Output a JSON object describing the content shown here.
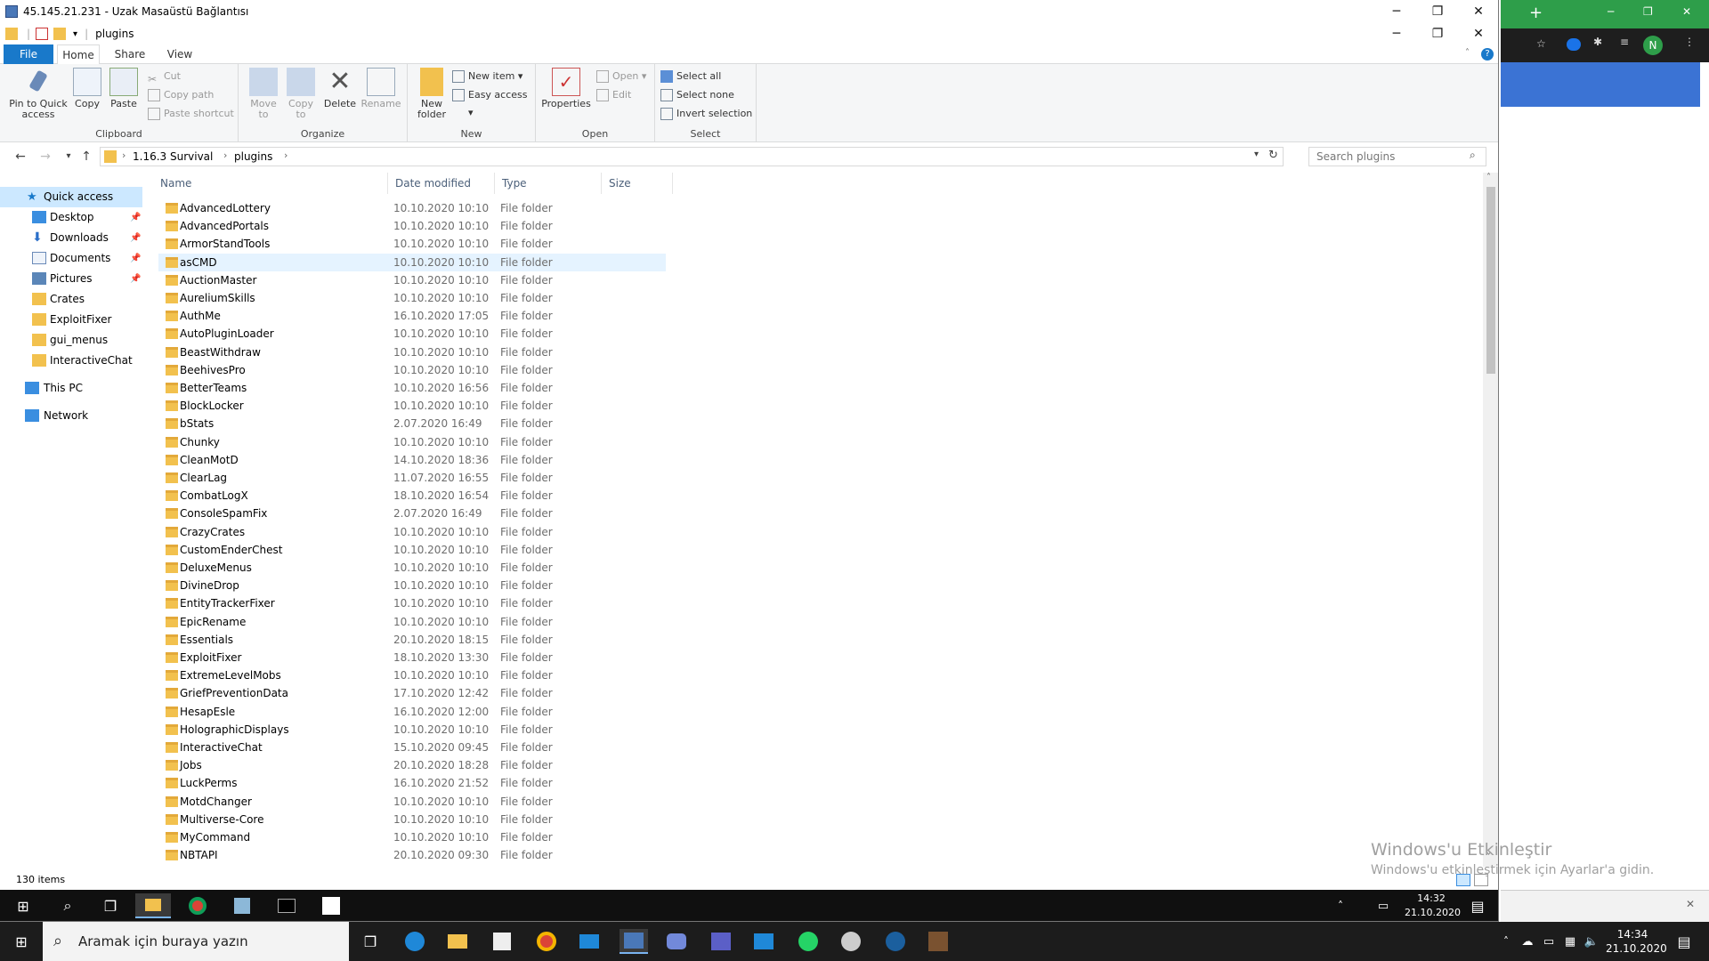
{
  "window": {
    "rdp_title": "45.145.21.231 - Uzak Masaüstü Bağlantısı",
    "explorer_title": "plugins",
    "controls": {
      "minimize": "─",
      "restore": "❐",
      "close": "✕"
    }
  },
  "ribbon": {
    "tabs": {
      "file": "File",
      "home": "Home",
      "share": "Share",
      "view": "View"
    },
    "clipboard": {
      "label": "Clipboard",
      "pin": "Pin to Quick access",
      "copy": "Copy",
      "paste": "Paste",
      "cut": "Cut",
      "copy_path": "Copy path",
      "paste_shortcut": "Paste shortcut"
    },
    "organize": {
      "label": "Organize",
      "move_to": "Move to",
      "copy_to": "Copy to",
      "delete": "Delete",
      "rename": "Rename"
    },
    "new": {
      "label": "New",
      "new_folder": "New folder",
      "new_item": "New item",
      "easy_access": "Easy access"
    },
    "open": {
      "label": "Open",
      "properties": "Properties",
      "open": "Open",
      "edit": "Edit"
    },
    "select": {
      "label": "Select",
      "select_all": "Select all",
      "select_none": "Select none",
      "invert": "Invert selection"
    }
  },
  "address": {
    "crumb1": "1.16.3 Survival",
    "crumb2": "plugins",
    "search_placeholder": "Search plugins"
  },
  "nav": {
    "quick_access": "Quick access",
    "items": [
      "Desktop",
      "Downloads",
      "Documents",
      "Pictures",
      "Crates",
      "ExploitFixer",
      "gui_menus",
      "InteractiveChat"
    ],
    "this_pc": "This PC",
    "network": "Network"
  },
  "columns": {
    "name": "Name",
    "date": "Date modified",
    "type": "Type",
    "size": "Size"
  },
  "files": [
    {
      "name": "AdvancedLottery",
      "date": "10.10.2020 10:10",
      "type": "File folder"
    },
    {
      "name": "AdvancedPortals",
      "date": "10.10.2020 10:10",
      "type": "File folder"
    },
    {
      "name": "ArmorStandTools",
      "date": "10.10.2020 10:10",
      "type": "File folder"
    },
    {
      "name": "asCMD",
      "date": "10.10.2020 10:10",
      "type": "File folder"
    },
    {
      "name": "AuctionMaster",
      "date": "10.10.2020 10:10",
      "type": "File folder"
    },
    {
      "name": "AureliumSkills",
      "date": "10.10.2020 10:10",
      "type": "File folder"
    },
    {
      "name": "AuthMe",
      "date": "16.10.2020 17:05",
      "type": "File folder"
    },
    {
      "name": "AutoPluginLoader",
      "date": "10.10.2020 10:10",
      "type": "File folder"
    },
    {
      "name": "BeastWithdraw",
      "date": "10.10.2020 10:10",
      "type": "File folder"
    },
    {
      "name": "BeehivesPro",
      "date": "10.10.2020 10:10",
      "type": "File folder"
    },
    {
      "name": "BetterTeams",
      "date": "10.10.2020 16:56",
      "type": "File folder"
    },
    {
      "name": "BlockLocker",
      "date": "10.10.2020 10:10",
      "type": "File folder"
    },
    {
      "name": "bStats",
      "date": "2.07.2020 16:49",
      "type": "File folder"
    },
    {
      "name": "Chunky",
      "date": "10.10.2020 10:10",
      "type": "File folder"
    },
    {
      "name": "CleanMotD",
      "date": "14.10.2020 18:36",
      "type": "File folder"
    },
    {
      "name": "ClearLag",
      "date": "11.07.2020 16:55",
      "type": "File folder"
    },
    {
      "name": "CombatLogX",
      "date": "18.10.2020 16:54",
      "type": "File folder"
    },
    {
      "name": "ConsoleSpamFix",
      "date": "2.07.2020 16:49",
      "type": "File folder"
    },
    {
      "name": "CrazyCrates",
      "date": "10.10.2020 10:10",
      "type": "File folder"
    },
    {
      "name": "CustomEnderChest",
      "date": "10.10.2020 10:10",
      "type": "File folder"
    },
    {
      "name": "DeluxeMenus",
      "date": "10.10.2020 10:10",
      "type": "File folder"
    },
    {
      "name": "DivineDrop",
      "date": "10.10.2020 10:10",
      "type": "File folder"
    },
    {
      "name": "EntityTrackerFixer",
      "date": "10.10.2020 10:10",
      "type": "File folder"
    },
    {
      "name": "EpicRename",
      "date": "10.10.2020 10:10",
      "type": "File folder"
    },
    {
      "name": "Essentials",
      "date": "20.10.2020 18:15",
      "type": "File folder"
    },
    {
      "name": "ExploitFixer",
      "date": "18.10.2020 13:30",
      "type": "File folder"
    },
    {
      "name": "ExtremeLevelMobs",
      "date": "10.10.2020 10:10",
      "type": "File folder"
    },
    {
      "name": "GriefPreventionData",
      "date": "17.10.2020 12:42",
      "type": "File folder"
    },
    {
      "name": "HesapEsle",
      "date": "16.10.2020 12:00",
      "type": "File folder"
    },
    {
      "name": "HolographicDisplays",
      "date": "10.10.2020 10:10",
      "type": "File folder"
    },
    {
      "name": "InteractiveChat",
      "date": "15.10.2020 09:45",
      "type": "File folder"
    },
    {
      "name": "Jobs",
      "date": "20.10.2020 18:28",
      "type": "File folder"
    },
    {
      "name": "LuckPerms",
      "date": "16.10.2020 21:52",
      "type": "File folder"
    },
    {
      "name": "MotdChanger",
      "date": "10.10.2020 10:10",
      "type": "File folder"
    },
    {
      "name": "Multiverse-Core",
      "date": "10.10.2020 10:10",
      "type": "File folder"
    },
    {
      "name": "MyCommand",
      "date": "10.10.2020 10:10",
      "type": "File folder"
    },
    {
      "name": "NBTAPI",
      "date": "20.10.2020 09:30",
      "type": "File folder"
    }
  ],
  "status": "130 items",
  "rdp_clock": {
    "time": "14:32",
    "date": "21.10.2020"
  },
  "host": {
    "search_placeholder": "Aramak için buraya yazın",
    "time": "14:34",
    "date": "21.10.2020"
  },
  "watermark": {
    "line1": "Windows'u Etkinleştir",
    "line2": "Windows'u etkinleştirmek için Ayarlar'a gidin."
  }
}
